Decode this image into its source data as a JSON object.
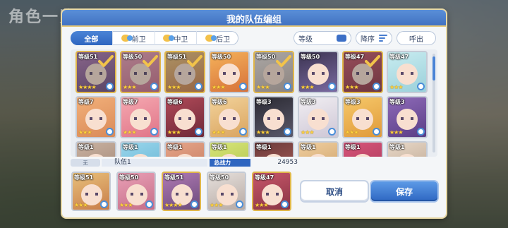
{
  "background": {
    "title": "角色一览"
  },
  "dialog": {
    "title": "我的队伍编组"
  },
  "filters": {
    "tabs": [
      {
        "label": "全部",
        "active": true
      },
      {
        "label": "前卫",
        "active": false
      },
      {
        "label": "中卫",
        "active": false
      },
      {
        "label": "后卫",
        "active": false
      }
    ],
    "sort_key": "等级",
    "order": "降序",
    "call_out": "呼出"
  },
  "roster": [
    {
      "level": "等级51",
      "stars": "★★★★",
      "selected": true,
      "palette": "p1",
      "rarity": "gold"
    },
    {
      "level": "等级50",
      "stars": "★★★",
      "selected": true,
      "palette": "p2",
      "rarity": "gold"
    },
    {
      "level": "等级51",
      "stars": "★★★",
      "selected": true,
      "palette": "p3",
      "rarity": "gold"
    },
    {
      "level": "等级50",
      "stars": "★★★",
      "selected": false,
      "palette": "p4",
      "rarity": "silver"
    },
    {
      "level": "等级50",
      "stars": "★★★",
      "selected": true,
      "palette": "p5",
      "rarity": "gold"
    },
    {
      "level": "等级50",
      "stars": "★★★",
      "selected": false,
      "palette": "p6",
      "rarity": "silver"
    },
    {
      "level": "等级47",
      "stars": "★★★",
      "selected": true,
      "palette": "p7",
      "rarity": "gold"
    },
    {
      "level": "等级47",
      "stars": "★★★",
      "selected": false,
      "palette": "p8",
      "rarity": "silver"
    },
    {
      "level": "等级7",
      "stars": "★★★",
      "selected": false,
      "palette": "p9",
      "rarity": "silver"
    },
    {
      "level": "等级7",
      "stars": "★★★",
      "selected": false,
      "palette": "p10",
      "rarity": "silver"
    },
    {
      "level": "等级6",
      "stars": "★★★",
      "selected": false,
      "palette": "p11",
      "rarity": "silver"
    },
    {
      "level": "等级6",
      "stars": "★★★",
      "selected": false,
      "palette": "p12",
      "rarity": "silver"
    },
    {
      "level": "等级3",
      "stars": "★★★",
      "selected": false,
      "palette": "p13",
      "rarity": "silver"
    },
    {
      "level": "等级3",
      "stars": "★★★",
      "selected": false,
      "palette": "p14",
      "rarity": "silver"
    },
    {
      "level": "等级3",
      "stars": "★★★",
      "selected": false,
      "palette": "p15",
      "rarity": "silver"
    },
    {
      "level": "等级3",
      "stars": "★★★",
      "selected": false,
      "palette": "p16",
      "rarity": "silver"
    },
    {
      "level": "等级1",
      "stars": "★★",
      "selected": false,
      "palette": "p17",
      "rarity": "silver"
    },
    {
      "level": "等级1",
      "stars": "★★",
      "selected": false,
      "palette": "p18",
      "rarity": "silver"
    },
    {
      "level": "等级1",
      "stars": "★★",
      "selected": false,
      "palette": "p19",
      "rarity": "silver"
    },
    {
      "level": "等级1",
      "stars": "★★",
      "selected": false,
      "palette": "p20",
      "rarity": "silver"
    },
    {
      "level": "等级1",
      "stars": "★★",
      "selected": false,
      "palette": "p21",
      "rarity": "silver"
    },
    {
      "level": "等级1",
      "stars": "★★",
      "selected": false,
      "palette": "p22",
      "rarity": "silver"
    },
    {
      "level": "等级1",
      "stars": "★★",
      "selected": false,
      "palette": "p23",
      "rarity": "silver"
    },
    {
      "level": "等级1",
      "stars": "★★",
      "selected": false,
      "palette": "p24",
      "rarity": "silver"
    }
  ],
  "party": {
    "tag": "无",
    "name": "队伍1",
    "power_label": "总战力",
    "power_value": "24953",
    "members": [
      {
        "level": "等级51",
        "stars": "★★★",
        "palette": "p3",
        "rarity": "silver"
      },
      {
        "level": "等级50",
        "stars": "★★★",
        "palette": "p2",
        "rarity": "silver"
      },
      {
        "level": "等级51",
        "stars": "★★★★",
        "palette": "p1",
        "rarity": "gold"
      },
      {
        "level": "等级50",
        "stars": "★★★",
        "palette": "p5",
        "rarity": "silver"
      },
      {
        "level": "等级47",
        "stars": "★★★",
        "palette": "p7",
        "rarity": "gold"
      }
    ]
  },
  "actions": {
    "cancel": "取消",
    "save": "保存"
  },
  "colors": {
    "accent": "#2f66c0",
    "check": "#f2c34a",
    "frame": "#e8d9a6"
  }
}
